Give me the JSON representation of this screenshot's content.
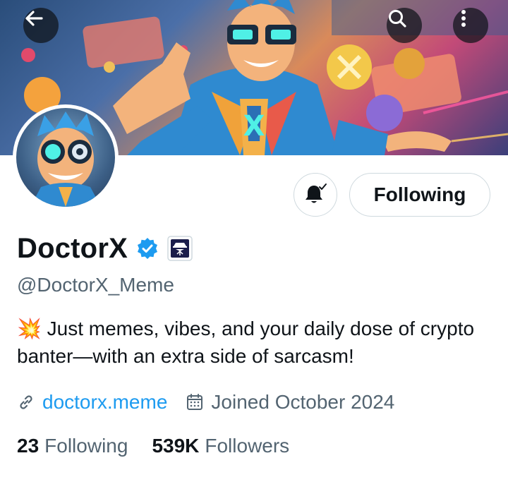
{
  "header": {
    "back_icon": "arrow-left-icon",
    "search_icon": "search-icon",
    "more_icon": "more-vertical-icon",
    "banner_image": "cartoon-doctor-x-banner"
  },
  "profile": {
    "avatar_image": "doctor-x-avatar",
    "display_name": "DoctorX",
    "verified_icon": "verified-badge-icon",
    "affiliate_icon": "spy-affiliate-badge-icon",
    "handle": "@DoctorX_Meme",
    "bio_emoji": "💥",
    "bio": "Just memes, vibes, and your daily dose of crypto banter—with an extra side of sarcasm!",
    "website": "doctorx.meme",
    "joined": "Joined October 2024",
    "link_icon": "link-icon",
    "calendar_icon": "calendar-icon"
  },
  "actions": {
    "notify_icon": "bell-check-icon",
    "following_label": "Following"
  },
  "stats": {
    "following_count": "23",
    "following_label": "Following",
    "followers_count": "539K",
    "followers_label": "Followers"
  },
  "colors": {
    "accent": "#1d9bf0",
    "text_primary": "#0f1419",
    "text_secondary": "#536471",
    "border": "#cfd9de"
  }
}
